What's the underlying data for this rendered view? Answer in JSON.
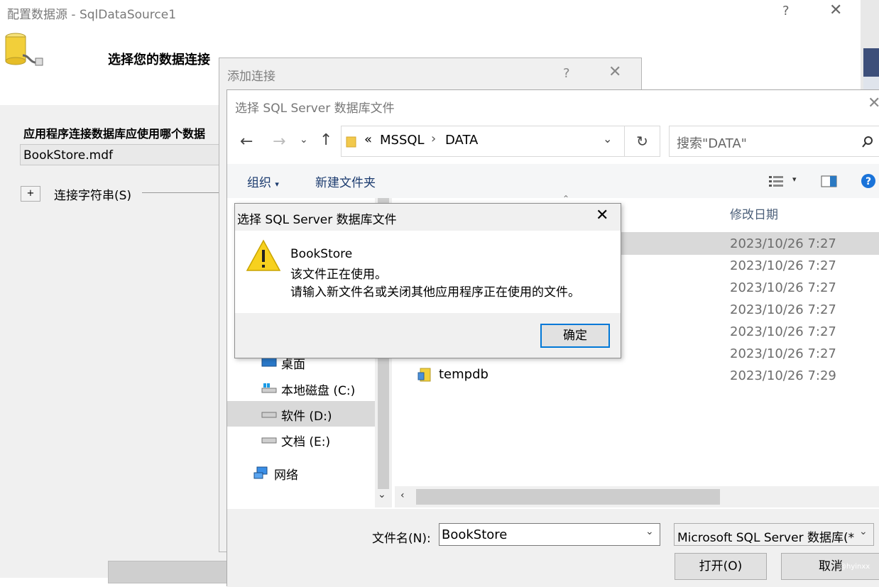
{
  "wizard": {
    "title": "配置数据源 - SqlDataSource1",
    "help": "?",
    "close": "✕",
    "header_title": "选择您的数据连接",
    "question": "应用程序连接数据库应使用哪个数据",
    "connection_value": "BookStore.mdf",
    "expand_label": "+",
    "connection_string_label": "连接字符串(S)"
  },
  "add_connection": {
    "title": "添加连接",
    "help": "?",
    "close": "✕"
  },
  "file_dialog": {
    "title": "选择 SQL Server 数据库文件",
    "close": "✕",
    "address": {
      "overflow": "«",
      "crumbs": [
        "MSSQL",
        "DATA"
      ],
      "separator": "›"
    },
    "search_placeholder": "搜索\"DATA\"",
    "commands": {
      "organize": "组织",
      "new_folder": "新建文件夹"
    },
    "columns": {
      "modified": "修改日期"
    },
    "nav_items": [
      {
        "label": "桌面",
        "icon": "desktop-icon"
      },
      {
        "label": "本地磁盘 (C:)",
        "icon": "drive-c-icon"
      },
      {
        "label": "软件 (D:)",
        "icon": "drive-icon",
        "selected": true
      },
      {
        "label": "文档 (E:)",
        "icon": "drive-icon"
      },
      {
        "label": "网络",
        "icon": "network-icon"
      }
    ],
    "file_dates": [
      "2023/10/26 7:27",
      "2023/10/26 7:27",
      "2023/10/26 7:27",
      "2023/10/26 7:27",
      "2023/10/26 7:27",
      "2023/10/26 7:27",
      "2023/10/26 7:29"
    ],
    "visible_file_name": "tempdb",
    "file_name_label": "文件名(N):",
    "file_name_value": "BookStore",
    "file_type_value": "Microsoft SQL Server 数据库(*",
    "open_button": "打开(O)",
    "cancel_button": "取消"
  },
  "message_box": {
    "title": "选择 SQL Server 数据库文件",
    "close": "✕",
    "line1": "BookStore",
    "line2": "该文件正在使用。",
    "line3": "请输入新文件名或关闭其他应用程序正在使用的文件。",
    "ok": "确定"
  },
  "watermark": "@hyinxx",
  "colors": {
    "accent": "#0078d7",
    "warning": "#f7d11e",
    "selection": "#d9d9d9"
  }
}
